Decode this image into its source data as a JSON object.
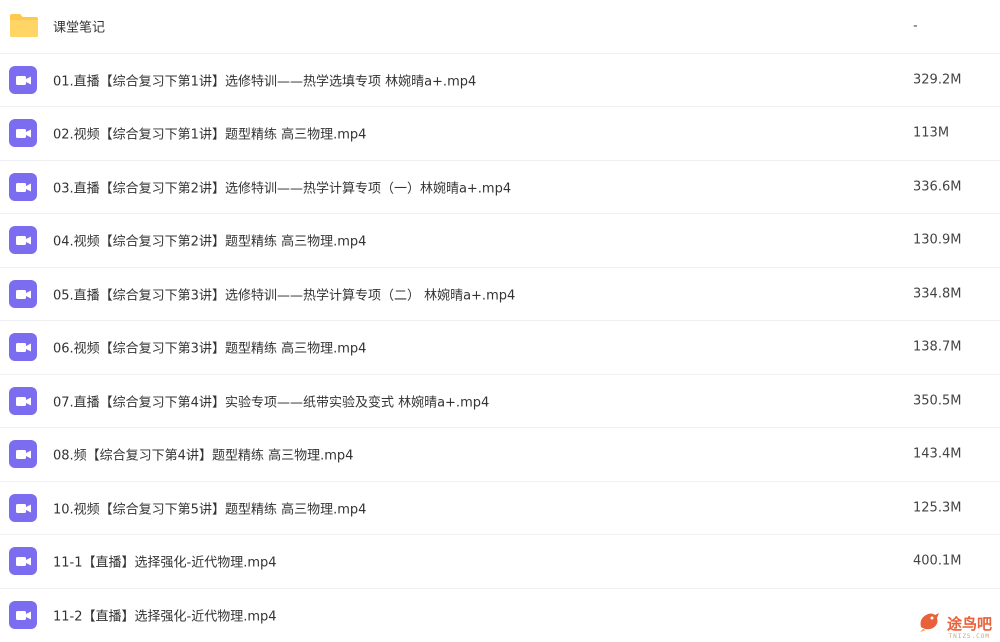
{
  "files": [
    {
      "type": "folder",
      "icon": "folder-icon",
      "name": "课堂笔记",
      "size": "-"
    },
    {
      "type": "video",
      "icon": "video-file-icon",
      "name": "01.直播【综合复习下第1讲】选修特训——热学选填专项 林婉晴a+.mp4",
      "size": "329.2M"
    },
    {
      "type": "video",
      "icon": "video-file-icon",
      "name": "02.视频【综合复习下第1讲】题型精练 高三物理.mp4",
      "size": "113M"
    },
    {
      "type": "video",
      "icon": "video-file-icon",
      "name": "03.直播【综合复习下第2讲】选修特训——热学计算专项（一）林婉晴a+.mp4",
      "size": "336.6M"
    },
    {
      "type": "video",
      "icon": "video-file-icon",
      "name": "04.视频【综合复习下第2讲】题型精练 高三物理.mp4",
      "size": "130.9M"
    },
    {
      "type": "video",
      "icon": "video-file-icon",
      "name": "05.直播【综合复习下第3讲】选修特训——热学计算专项（二） 林婉晴a+.mp4",
      "size": "334.8M"
    },
    {
      "type": "video",
      "icon": "video-file-icon",
      "name": "06.视频【综合复习下第3讲】题型精练 高三物理.mp4",
      "size": "138.7M"
    },
    {
      "type": "video",
      "icon": "video-file-icon",
      "name": "07.直播【综合复习下第4讲】实验专项——纸带实验及变式 林婉晴a+.mp4",
      "size": "350.5M"
    },
    {
      "type": "video",
      "icon": "video-file-icon",
      "name": "08.频【综合复习下第4讲】题型精练 高三物理.mp4",
      "size": "143.4M"
    },
    {
      "type": "video",
      "icon": "video-file-icon",
      "name": "10.视频【综合复习下第5讲】题型精练 高三物理.mp4",
      "size": "125.3M"
    },
    {
      "type": "video",
      "icon": "video-file-icon",
      "name": "11-1【直播】选择强化-近代物理.mp4",
      "size": "400.1M"
    },
    {
      "type": "video",
      "icon": "video-file-icon",
      "name": "11-2【直播】选择强化-近代物理.mp4",
      "size": ""
    }
  ],
  "watermark": {
    "text": "途鸟吧",
    "sub": "TNIZS.COM"
  },
  "colors": {
    "video_icon": "#7b6cf0",
    "folder_icon": "#ffc94d",
    "row_divider": "#eef0f4"
  }
}
